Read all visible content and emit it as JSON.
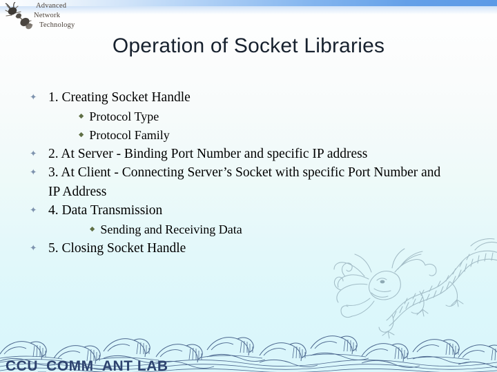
{
  "slide": {
    "title": "Operation of Socket Libraries",
    "footer": "CCU_COMM_ANT LAB",
    "logo": {
      "line1": "Advanced",
      "line2": "Network",
      "line3": "Technology",
      "icon": "ant-icon"
    },
    "bullet_marks": {
      "level1": "✦",
      "level2": "◆"
    },
    "colors": {
      "title": "#17212e",
      "body_text": "#000000",
      "level1_bullet": "#7e93ae",
      "level2_bullet": "#5f6f45",
      "footer": "#2e4470",
      "top_band": "#5c9ae6",
      "background_top": "#ffffff",
      "background_bottom": "#d9f6fb",
      "watermark": "#7d98a6"
    },
    "content": [
      {
        "level": 1,
        "text": "1. Creating Socket Handle"
      },
      {
        "level": 2,
        "indent": "a",
        "text": "Protocol Type"
      },
      {
        "level": 2,
        "indent": "a",
        "text": "Protocol Family"
      },
      {
        "level": 1,
        "text": "2. At Server - Binding Port Number and specific IP address"
      },
      {
        "level": 1,
        "text": "3. At Client - Connecting Server’s Socket with specific Port Number and"
      },
      {
        "level": 0,
        "text": "IP Address"
      },
      {
        "level": 1,
        "text": "4. Data Transmission"
      },
      {
        "level": 2,
        "indent": "b",
        "text": "Sending and Receiving Data"
      },
      {
        "level": 1,
        "text": "5. Closing Socket Handle"
      }
    ]
  }
}
